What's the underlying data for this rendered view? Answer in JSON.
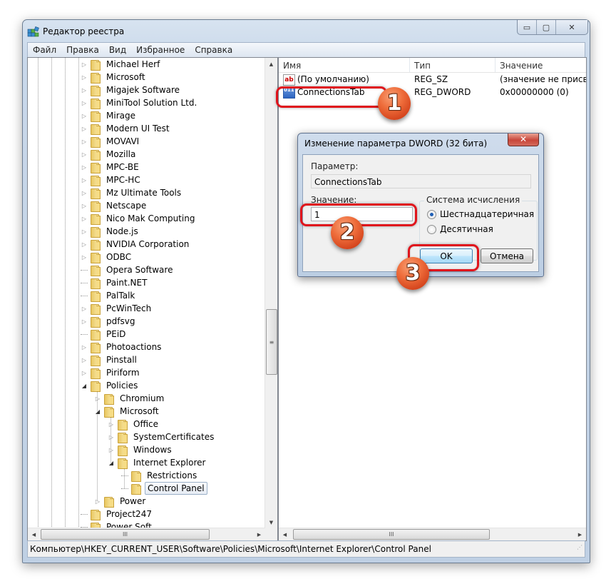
{
  "window": {
    "title": "Редактор реестра",
    "caption": {
      "minimize": "▭",
      "maximize": "▢",
      "close": "✕"
    }
  },
  "menu": [
    "Файл",
    "Правка",
    "Вид",
    "Избранное",
    "Справка"
  ],
  "tree": {
    "items": [
      {
        "label": "Michael Herf",
        "level": 0,
        "expander": "collapsed"
      },
      {
        "label": "Microsoft",
        "level": 0,
        "expander": "collapsed"
      },
      {
        "label": "Migajek Software",
        "level": 0,
        "expander": "collapsed"
      },
      {
        "label": "MiniTool Solution Ltd.",
        "level": 0,
        "expander": "collapsed"
      },
      {
        "label": "Mirage",
        "level": 0,
        "expander": "collapsed"
      },
      {
        "label": "Modern UI Test",
        "level": 0,
        "expander": "collapsed"
      },
      {
        "label": "MOVAVI",
        "level": 0,
        "expander": "collapsed"
      },
      {
        "label": "Mozilla",
        "level": 0,
        "expander": "collapsed"
      },
      {
        "label": "MPC-BE",
        "level": 0,
        "expander": "collapsed"
      },
      {
        "label": "MPC-HC",
        "level": 0,
        "expander": "collapsed"
      },
      {
        "label": "Mz Ultimate Tools",
        "level": 0,
        "expander": "collapsed"
      },
      {
        "label": "Netscape",
        "level": 0,
        "expander": "collapsed"
      },
      {
        "label": "Nico Mak Computing",
        "level": 0,
        "expander": "collapsed"
      },
      {
        "label": "Node.js",
        "level": 0,
        "expander": "collapsed"
      },
      {
        "label": "NVIDIA Corporation",
        "level": 0,
        "expander": "collapsed"
      },
      {
        "label": "ODBC",
        "level": 0,
        "expander": "collapsed"
      },
      {
        "label": "Opera Software",
        "level": 0,
        "expander": "none"
      },
      {
        "label": "Paint.NET",
        "level": 0,
        "expander": "none"
      },
      {
        "label": "PalTalk",
        "level": 0,
        "expander": "none"
      },
      {
        "label": "PcWinTech",
        "level": 0,
        "expander": "collapsed"
      },
      {
        "label": "pdfsvg",
        "level": 0,
        "expander": "collapsed"
      },
      {
        "label": "PEiD",
        "level": 0,
        "expander": "none"
      },
      {
        "label": "Photoactions",
        "level": 0,
        "expander": "collapsed"
      },
      {
        "label": "Pinstall",
        "level": 0,
        "expander": "collapsed"
      },
      {
        "label": "Piriform",
        "level": 0,
        "expander": "collapsed"
      },
      {
        "label": "Policies",
        "level": 0,
        "expander": "expanded"
      },
      {
        "label": "Chromium",
        "level": 1,
        "expander": "collapsed"
      },
      {
        "label": "Microsoft",
        "level": 1,
        "expander": "expanded"
      },
      {
        "label": "Office",
        "level": 2,
        "expander": "collapsed"
      },
      {
        "label": "SystemCertificates",
        "level": 2,
        "expander": "collapsed"
      },
      {
        "label": "Windows",
        "level": 2,
        "expander": "collapsed"
      },
      {
        "label": "Internet Explorer",
        "level": 2,
        "expander": "expanded"
      },
      {
        "label": "Restrictions",
        "level": 3,
        "expander": "none"
      },
      {
        "label": "Control Panel",
        "level": 3,
        "expander": "none",
        "selected": true
      },
      {
        "label": "Power",
        "level": 1,
        "expander": "collapsed"
      },
      {
        "label": "Project247",
        "level": 0,
        "expander": "none"
      },
      {
        "label": "Power Soft",
        "level": 0,
        "expander": "none"
      }
    ]
  },
  "list": {
    "columns": [
      "Имя",
      "Тип",
      "Значение"
    ],
    "rows": [
      {
        "icon": "string-value-icon",
        "glyph": "ab",
        "name": "(По умолчанию)",
        "type": "REG_SZ",
        "value": "(значение не присво"
      },
      {
        "icon": "binary-value-icon",
        "glyph": "011 110",
        "name": "ConnectionsTab",
        "type": "REG_DWORD",
        "value": "0x00000000 (0)"
      }
    ]
  },
  "statusbar": {
    "path": "Компьютер\\HKEY_CURRENT_USER\\Software\\Policies\\Microsoft\\Internet Explorer\\Control Panel"
  },
  "dialog": {
    "title": "Изменение параметра DWORD (32 бита)",
    "close": "✕",
    "param_label": "Параметр:",
    "param_value": "ConnectionsTab",
    "value_label": "Значение:",
    "value": "1",
    "base_group_title": "Система исчисления",
    "base_options": [
      {
        "label": "Шестнадцатеричная",
        "checked": true
      },
      {
        "label": "Десятичная",
        "checked": false
      }
    ],
    "ok_label": "OK",
    "cancel_label": "Отмена"
  },
  "annotations": {
    "step1": "1",
    "step2": "2",
    "step3": "3",
    "highlight_color": "#e0141c",
    "badge_color": "#e45a2a"
  },
  "scroll": {
    "grip": "≡",
    "hgrip": "III",
    "up": "▲",
    "down": "▼",
    "left": "◀",
    "right": "▶"
  }
}
